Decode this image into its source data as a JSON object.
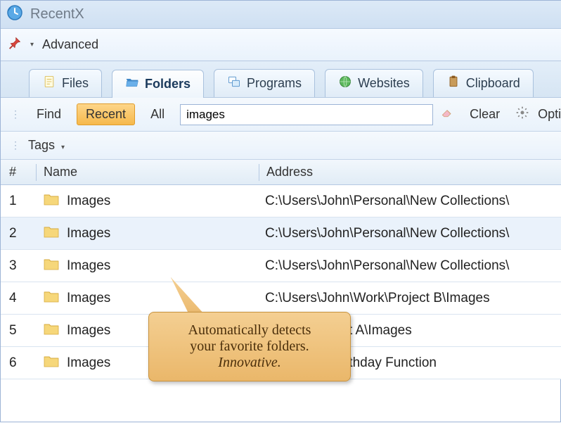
{
  "window": {
    "title": "RecentX"
  },
  "toolbar": {
    "advanced": "Advanced"
  },
  "tabs": {
    "files": "Files",
    "folders": "Folders",
    "programs": "Programs",
    "websites": "Websites",
    "clipboard": "Clipboard"
  },
  "filter": {
    "find": "Find",
    "recent": "Recent",
    "all": "All",
    "search_value": "images",
    "clear": "Clear",
    "options": "Option"
  },
  "tags": {
    "label": "Tags"
  },
  "columns": {
    "num": "#",
    "name": "Name",
    "address": "Address"
  },
  "rows": [
    {
      "num": "1",
      "name": "Images",
      "address": "C:\\Users\\John\\Personal\\New Collections\\"
    },
    {
      "num": "2",
      "name": "Images",
      "address": "C:\\Users\\John\\Personal\\New Collections\\"
    },
    {
      "num": "3",
      "name": "Images",
      "address": "C:\\Users\\John\\Personal\\New Collections\\"
    },
    {
      "num": "4",
      "name": "Images",
      "address": "C:\\Users\\John\\Work\\Project B\\Images"
    },
    {
      "num": "5",
      "name": "Images",
      "address": "n\\Work\\Project A\\Images"
    },
    {
      "num": "6",
      "name": "Images",
      "address": "n\\Personal\\Birthday Function"
    }
  ],
  "callout": {
    "line1": "Automatically detects",
    "line2": "your favorite folders.",
    "line3": "Innovative."
  }
}
